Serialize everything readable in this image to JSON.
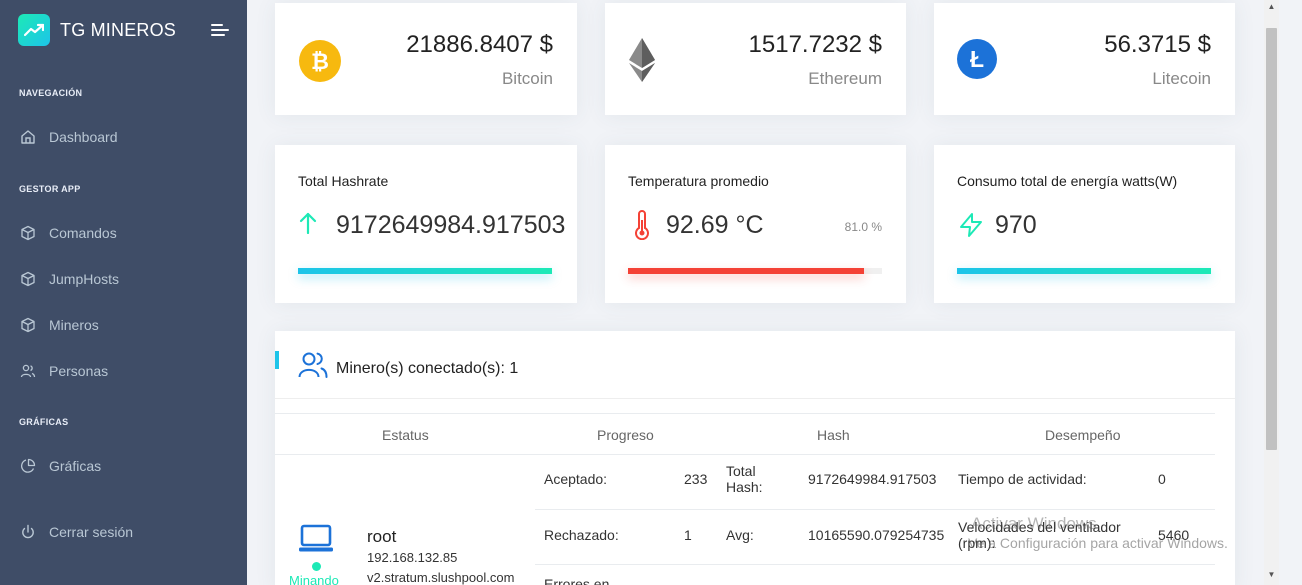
{
  "brand": {
    "name": "TG MINEROS"
  },
  "nav": {
    "caption_navegacion": "NAVEGACIÓN",
    "dashboard": "Dashboard",
    "caption_gestor": "GESTOR APP",
    "comandos": "Comandos",
    "jumphosts": "JumpHosts",
    "mineros": "Mineros",
    "personas": "Personas",
    "caption_graficas": "GRÁFICAS",
    "graficas": "Gráficas",
    "logout": "Cerrar sesión"
  },
  "coins": [
    {
      "price": "21886.8407 $",
      "name": "Bitcoin",
      "color": "#f7b90f"
    },
    {
      "price": "1517.7232 $",
      "name": "Ethereum",
      "color": "#555555"
    },
    {
      "price": "56.3715 $",
      "name": "Litecoin",
      "color": "#1c72d8"
    }
  ],
  "stats": {
    "hashrate": {
      "title": "Total Hashrate",
      "value": "9172649984.917503",
      "progress": 1.0,
      "color": "#1dc4e9"
    },
    "temperature": {
      "title": "Temperatura promedio",
      "value": "92.69 °C",
      "percent": "81.0 %",
      "progress": 0.93,
      "color": "#f44236"
    },
    "energy": {
      "title": "Consumo total de energía watts(W)",
      "value": "970",
      "progress": 1.0,
      "color": "#1dc4e9"
    }
  },
  "miners": {
    "title": "Minero(s) conectado(s): 1",
    "headers": {
      "status": "Estatus",
      "progress": "Progreso",
      "hash": "Hash",
      "performance": "Desempeño"
    },
    "row": {
      "host": "root",
      "ip": "192.168.132.85",
      "pool": "v2.stratum.slushpool.com",
      "status": "Minando",
      "accepted_label": "Aceptado:",
      "accepted_value": "233",
      "rejected_label": "Rechazado:",
      "rejected_value": "1",
      "errors_label": "Errores en",
      "total_hash_label": "Total Hash:",
      "total_hash_value": "9172649984.917503",
      "avg_label": "Avg:",
      "avg_value": "10165590.079254735",
      "uptime_label": "Tiempo de actividad:",
      "uptime_value": "0",
      "fan_label": "Velocidades del ventilador (rpm):",
      "fan_value": "5460"
    }
  },
  "watermark": {
    "title": "Activar Windows",
    "subtitle": "Ve a Configuración para activar Windows."
  }
}
